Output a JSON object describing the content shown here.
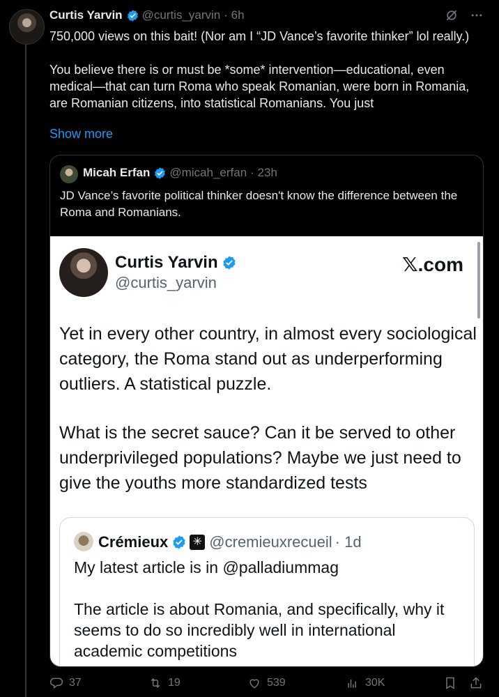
{
  "author": {
    "name": "Curtis Yarvin",
    "handle": "@curtis_yarvin",
    "time": "· 6h"
  },
  "tweet": {
    "para1": "750,000 views on this bait! (Nor am I “JD Vance’s favorite thinker” lol really.)",
    "para2": "You believe there is or must be *some* intervention—educational, even medical—that can turn Roma who speak Romanian, were born in Romania, are Romanian citizens, into statistical Romanians. You just",
    "show_more": "Show more"
  },
  "quote": {
    "name": "Micah Erfan",
    "handle": "@micah_erfan",
    "time": "· 23h",
    "text": "JD Vance’s favorite political thinker doesn't know the difference between the Roma and Romanians."
  },
  "card": {
    "name": "Curtis Yarvin",
    "handle": "@curtis_yarvin",
    "brand": "𝕏.com",
    "para1": "Yet in every other country, in almost every sociological category, the Roma stand out as underperforming outliers. A statistical puzzle.",
    "para2": "What is the secret sauce? Can it be served to other underprivileged populations? Maybe we just need to give the youths more standardized tests"
  },
  "inner_quote": {
    "name": "Crémieux",
    "badge": "✳",
    "handle": "@cremieuxrecueil",
    "time": "· 1d",
    "para1": "My latest article is in @palladiummag",
    "para2": "The article is about Romania, and specifically, why it seems to do so incredibly well in international academic competitions"
  },
  "actions": {
    "replies": "37",
    "reposts": "19",
    "likes": "539",
    "views": "30K"
  },
  "colors": {
    "background": "#000000",
    "accent": "#1d9bf0",
    "muted": "#71767b"
  },
  "icons": [
    "verified-icon",
    "grok-icon",
    "more-icon",
    "reply-icon",
    "repost-icon",
    "like-icon",
    "views-icon",
    "bookmark-icon",
    "share-icon"
  ]
}
